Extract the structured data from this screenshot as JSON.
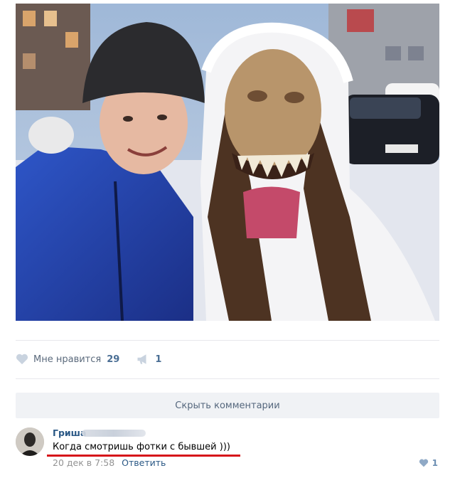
{
  "post": {
    "photo_alt": "",
    "likes_label": "Мне нравится",
    "likes_count": "29",
    "shares_count": "1"
  },
  "comments_toggle": {
    "label": "Скрыть комментарии"
  },
  "comment": {
    "author": "Гриша",
    "text": "Когда смотришь фотки с бывшей )))",
    "date": "20 дек в 7:58",
    "reply_label": "Ответить",
    "likes_count": "1"
  },
  "colors": {
    "link": "#2a5885",
    "muted": "#939393",
    "button_bg": "#f0f2f5",
    "highlight_underline": "#d6141a"
  },
  "icons": {
    "like": "heart-icon",
    "share": "megaphone-icon",
    "comment_like": "heart-icon"
  }
}
